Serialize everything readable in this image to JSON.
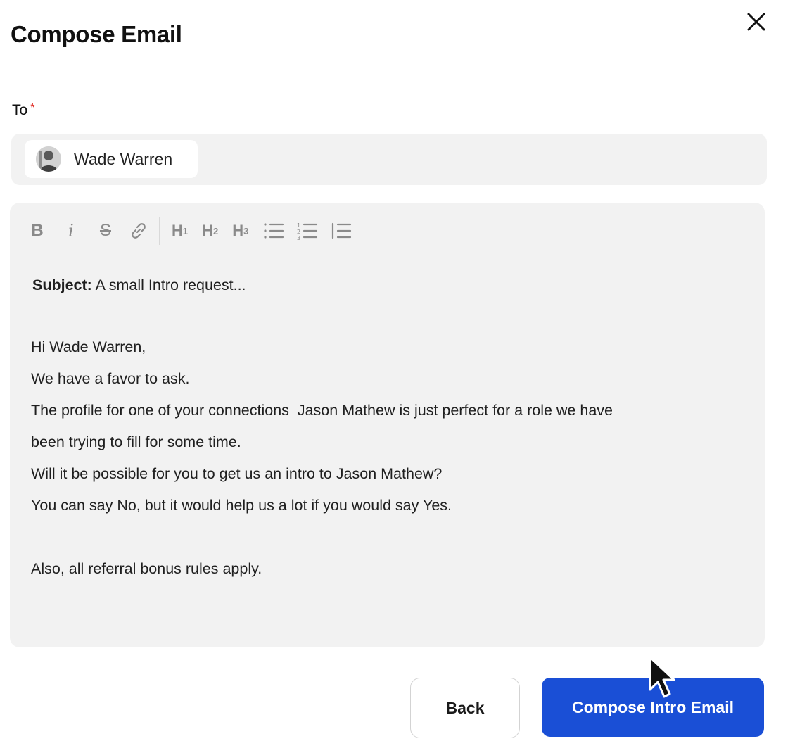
{
  "dialog": {
    "title": "Compose Email"
  },
  "to": {
    "label": "To",
    "required_mark": "*",
    "recipient": {
      "name": "Wade Warren"
    }
  },
  "toolbar": {
    "bold": "B",
    "italic": "i",
    "strike": "S",
    "h1": "H",
    "h1_level": "1",
    "h2": "H",
    "h2_level": "2",
    "h3": "H",
    "h3_level": "3",
    "icons": [
      "link-icon",
      "bullet-list-icon",
      "numbered-list-icon",
      "blockquote-icon"
    ]
  },
  "email": {
    "subject_label": "Subject:",
    "subject": "A small Intro request...",
    "lines": [
      "Hi Wade Warren,",
      "We have a favor to ask.",
      "The profile for one of your connections  Jason Mathew is just perfect for a role we have",
      "been trying to fill for some time.",
      "Will it be possible for you to get us an intro to Jason Mathew?",
      "You can say No, but it would help us a lot if you would say Yes.",
      "",
      "Also, all referral bonus rules apply."
    ]
  },
  "actions": {
    "back_label": "Back",
    "primary_label": "Compose Intro Email"
  },
  "colors": {
    "primary": "#1a4fd6",
    "field_bg": "#f2f2f2",
    "required": "#e0322b",
    "toolbar_icon": "#8a8a8a"
  }
}
